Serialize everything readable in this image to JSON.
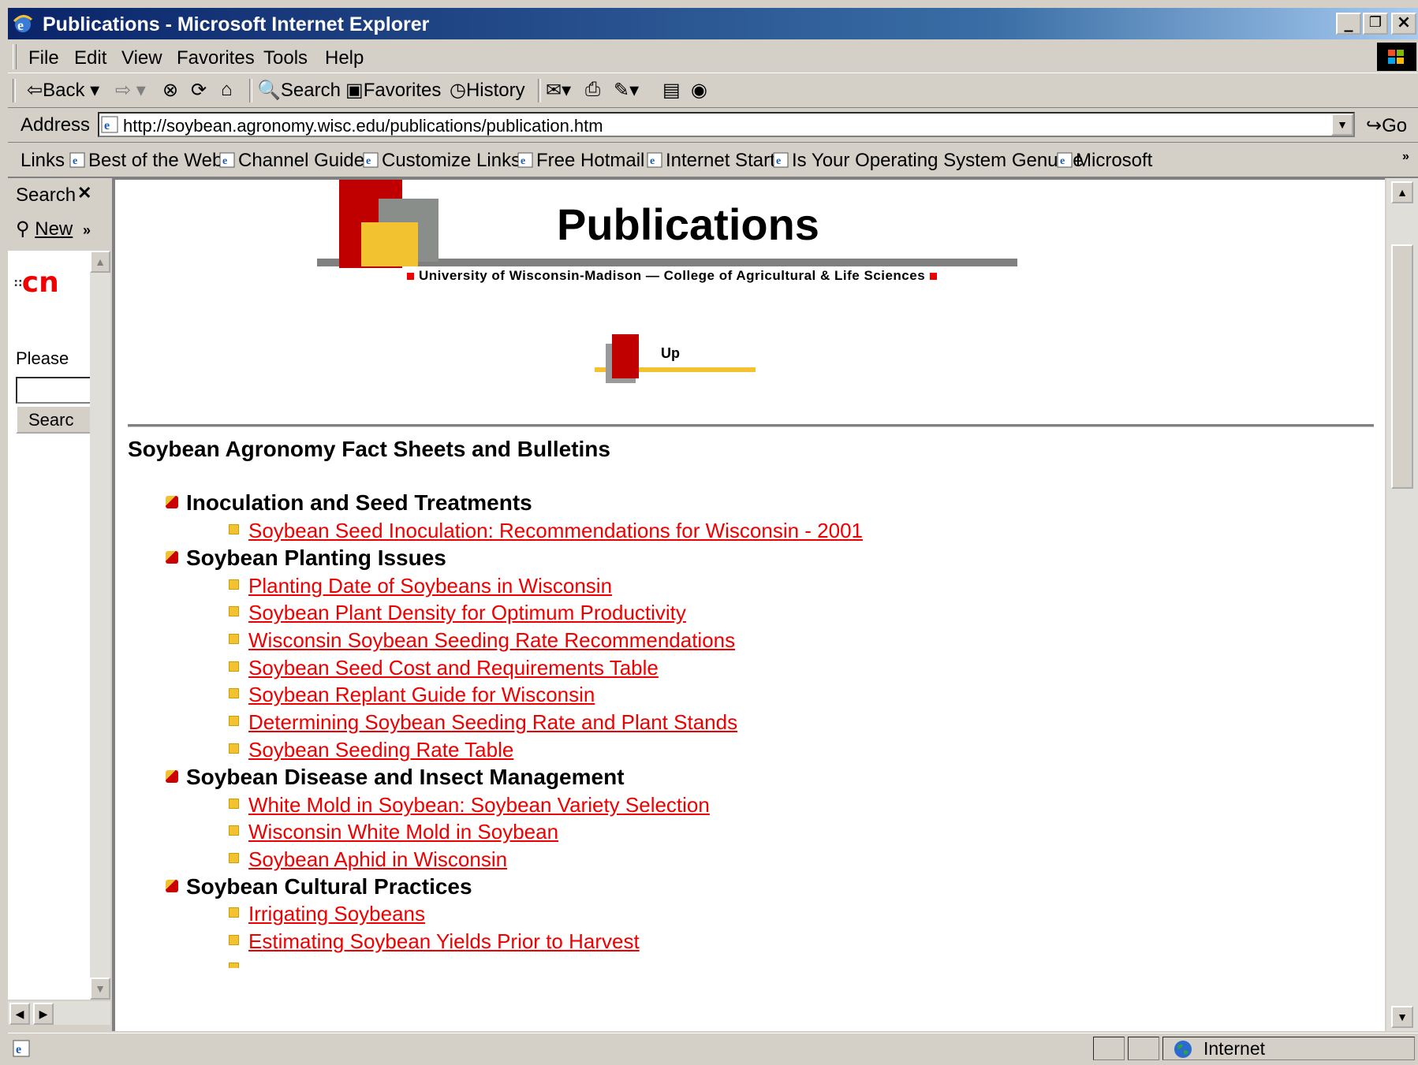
{
  "window": {
    "title": "Publications - Microsoft Internet Explorer"
  },
  "menu": {
    "items": [
      "File",
      "Edit",
      "View",
      "Favorites",
      "Tools",
      "Help"
    ]
  },
  "toolbar": {
    "back": "Back",
    "search": "Search",
    "favorites": "Favorites",
    "history": "History"
  },
  "address": {
    "label": "Address",
    "url": "http://soybean.agronomy.wisc.edu/publications/publication.htm",
    "go": "Go"
  },
  "links": {
    "label": "Links",
    "items": [
      "Best of the Web",
      "Channel Guide",
      "Customize Links",
      "Free Hotmail",
      "Internet Start",
      "Is Your Operating System Genuine",
      "Microsoft"
    ]
  },
  "explorer": {
    "title": "Search",
    "new": "New",
    "logo": "cn",
    "prompt": "Please",
    "button": "Searc"
  },
  "page": {
    "title": "Publications",
    "subtitle": "University of Wisconsin-Madison — College of Agricultural & Life Sciences",
    "up": "Up",
    "section": "Soybean Agronomy Fact Sheets and Bulletins",
    "categories": [
      {
        "name": "Inoculation and Seed Treatments",
        "links": [
          "Soybean Seed Inoculation: Recommendations for Wisconsin - 2001"
        ]
      },
      {
        "name": "Soybean Planting Issues",
        "links": [
          "Planting Date of Soybeans in Wisconsin",
          "Soybean Plant Density for Optimum Productivity",
          "Wisconsin Soybean Seeding Rate Recommendations",
          "Soybean Seed Cost and Requirements Table",
          "Soybean Replant Guide for Wisconsin",
          "Determining Soybean Seeding Rate and Plant Stands",
          "Soybean Seeding Rate Table"
        ]
      },
      {
        "name": "Soybean Disease and Insect Management",
        "links": [
          "White Mold in Soybean: Soybean Variety Selection",
          "Wisconsin White Mold in Soybean",
          "Soybean Aphid in Wisconsin"
        ]
      },
      {
        "name": "Soybean Cultural Practices",
        "links": [
          "Irrigating Soybeans",
          "Estimating Soybean Yields Prior to Harvest"
        ]
      }
    ]
  },
  "status": {
    "zone": "Internet"
  },
  "colors": {
    "link": "#e00000",
    "accent_red": "#c00000",
    "accent_yellow": "#f2c230",
    "titlebar": "#0a246a"
  }
}
